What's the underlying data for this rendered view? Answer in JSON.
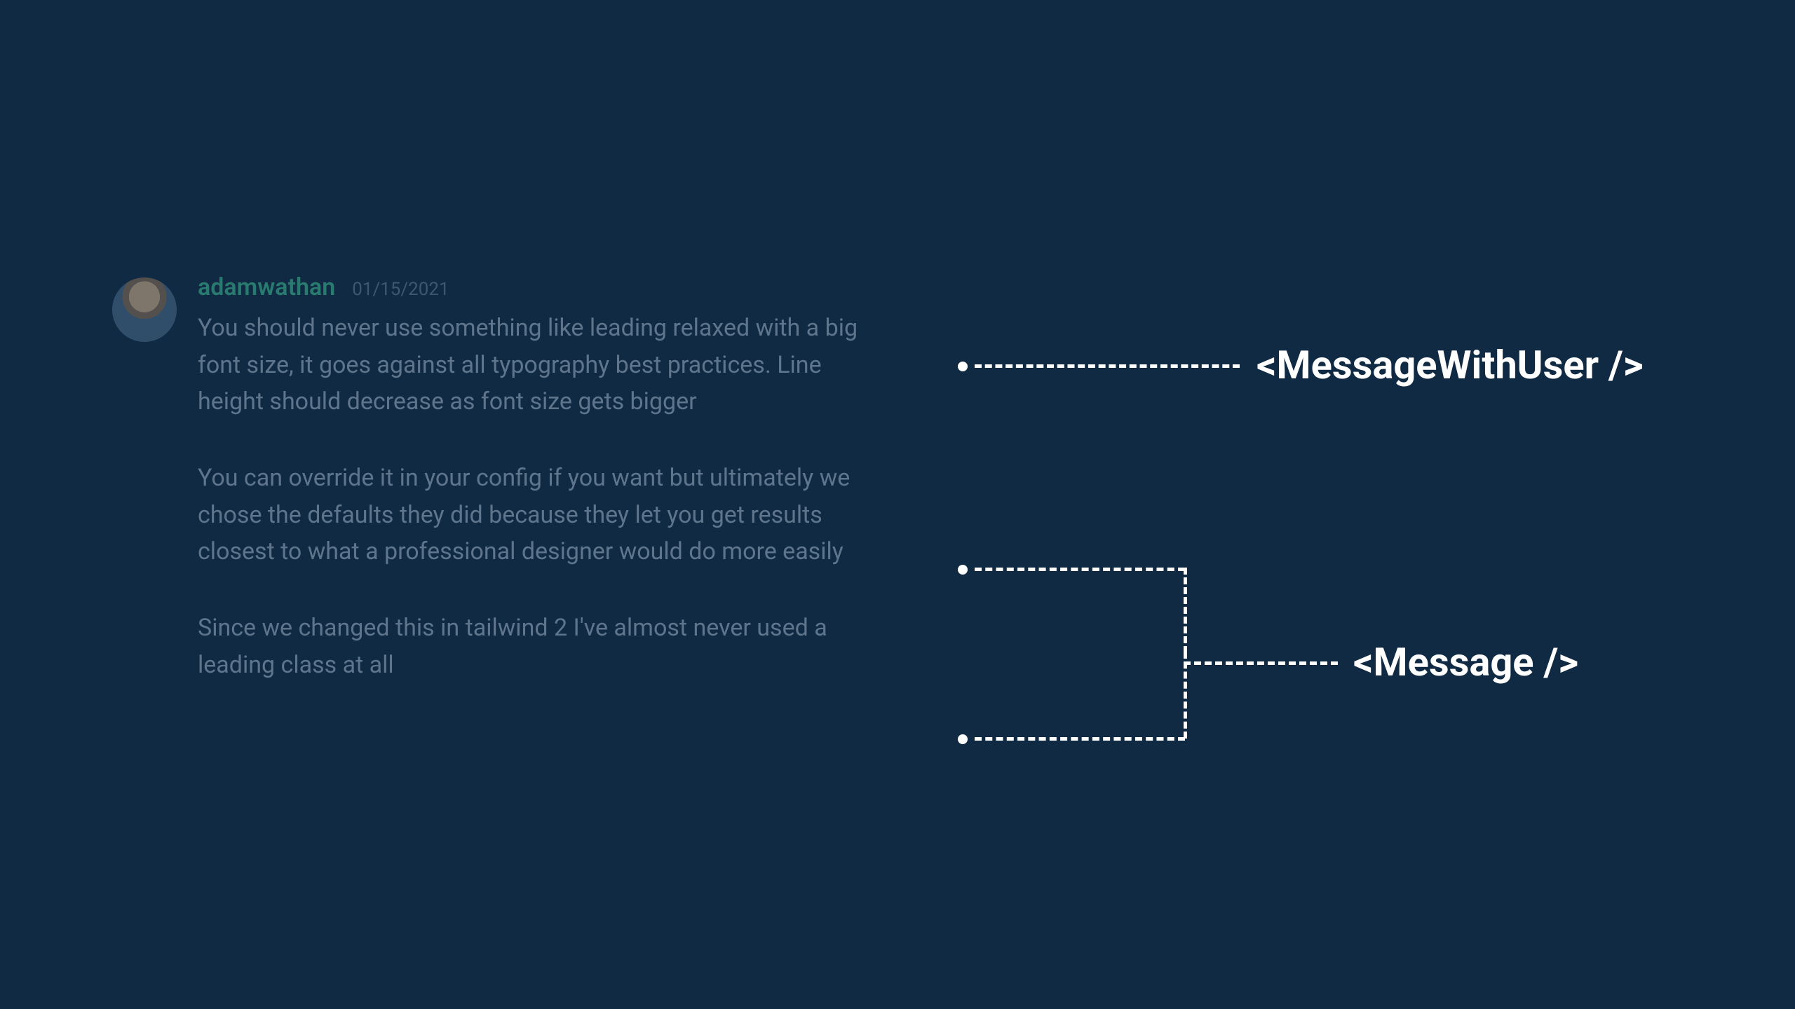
{
  "message": {
    "username": "adamwathan",
    "timestamp": "01/15/2021",
    "paragraphs": [
      "You should never use something like leading relaxed with a big font size, it goes against all typography best practices. Line height should decrease as font size gets bigger",
      "You can override it in your config if you want but ultimately we chose the defaults they did because they let you get results closest to what a professional designer would do more easily",
      "Since we changed this in tailwind 2 I've almost never used a leading class at all"
    ],
    "avatar_icon": "person-avatar"
  },
  "labels": {
    "message_with_user": "<MessageWithUser />",
    "message": "<Message />"
  },
  "colors": {
    "background": "#102a43",
    "body_text": "#9fb3c8",
    "username": "#3ebd93",
    "timestamp": "#627d98",
    "annotation": "#ffffff"
  }
}
